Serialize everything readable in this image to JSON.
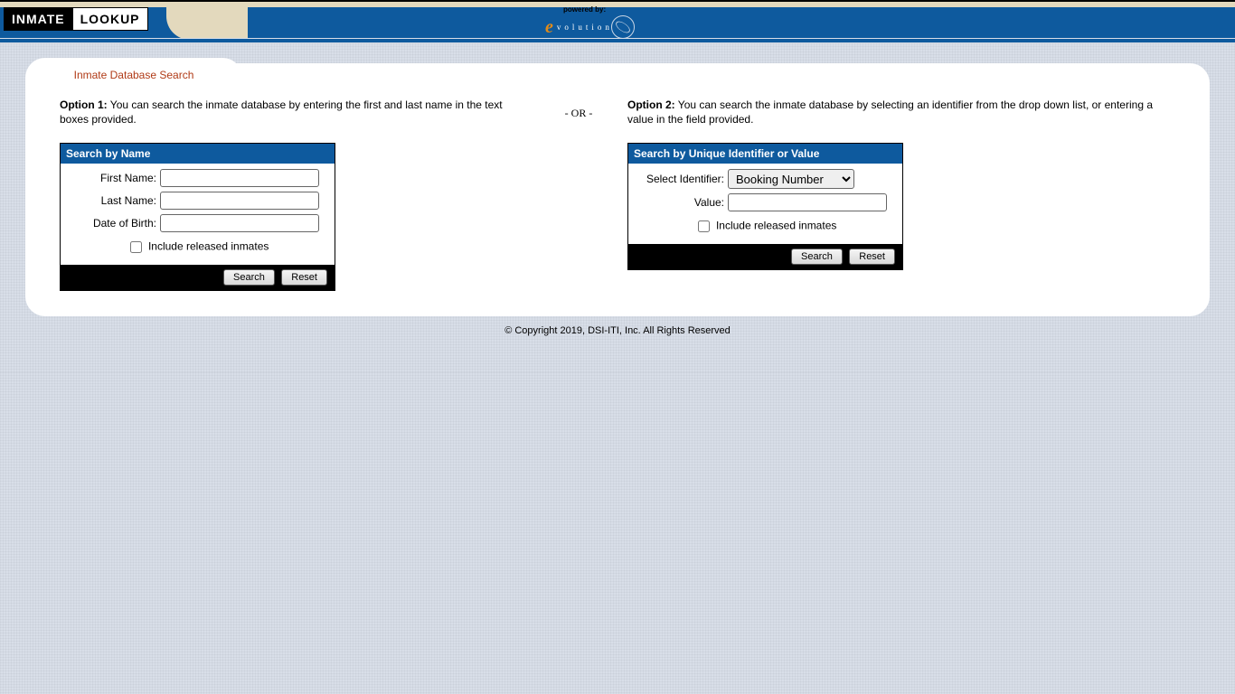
{
  "header": {
    "logo_word1": "INMATE",
    "logo_word2": "LOOKUP",
    "powered_by_label": "powered by:",
    "brand_e": "e",
    "brand_rest": "volution"
  },
  "tab": {
    "title": "Inmate Database Search"
  },
  "option1": {
    "prefix": "Option 1:",
    "text": " You can search the inmate database by entering the first and last name in the text boxes provided."
  },
  "or_divider": "- OR -",
  "option2": {
    "prefix": "Option 2:",
    "text": " You can search the inmate database by selecting an identifier from the drop down list, or entering a value in the field provided."
  },
  "name_box": {
    "header": "Search by Name",
    "first_name_label": "First Name:",
    "last_name_label": "Last Name:",
    "dob_label": "Date of Birth:",
    "include_released_label": "Include released inmates",
    "search_btn": "Search",
    "reset_btn": "Reset"
  },
  "id_box": {
    "header": "Search by Unique Identifier or Value",
    "select_label": "Select Identifier:",
    "selected_option": "Booking Number",
    "value_label": "Value:",
    "include_released_label": "Include released inmates",
    "search_btn": "Search",
    "reset_btn": "Reset"
  },
  "footer": {
    "copyright": "© Copyright 2019, DSI-ITI, Inc. All Rights Reserved"
  }
}
